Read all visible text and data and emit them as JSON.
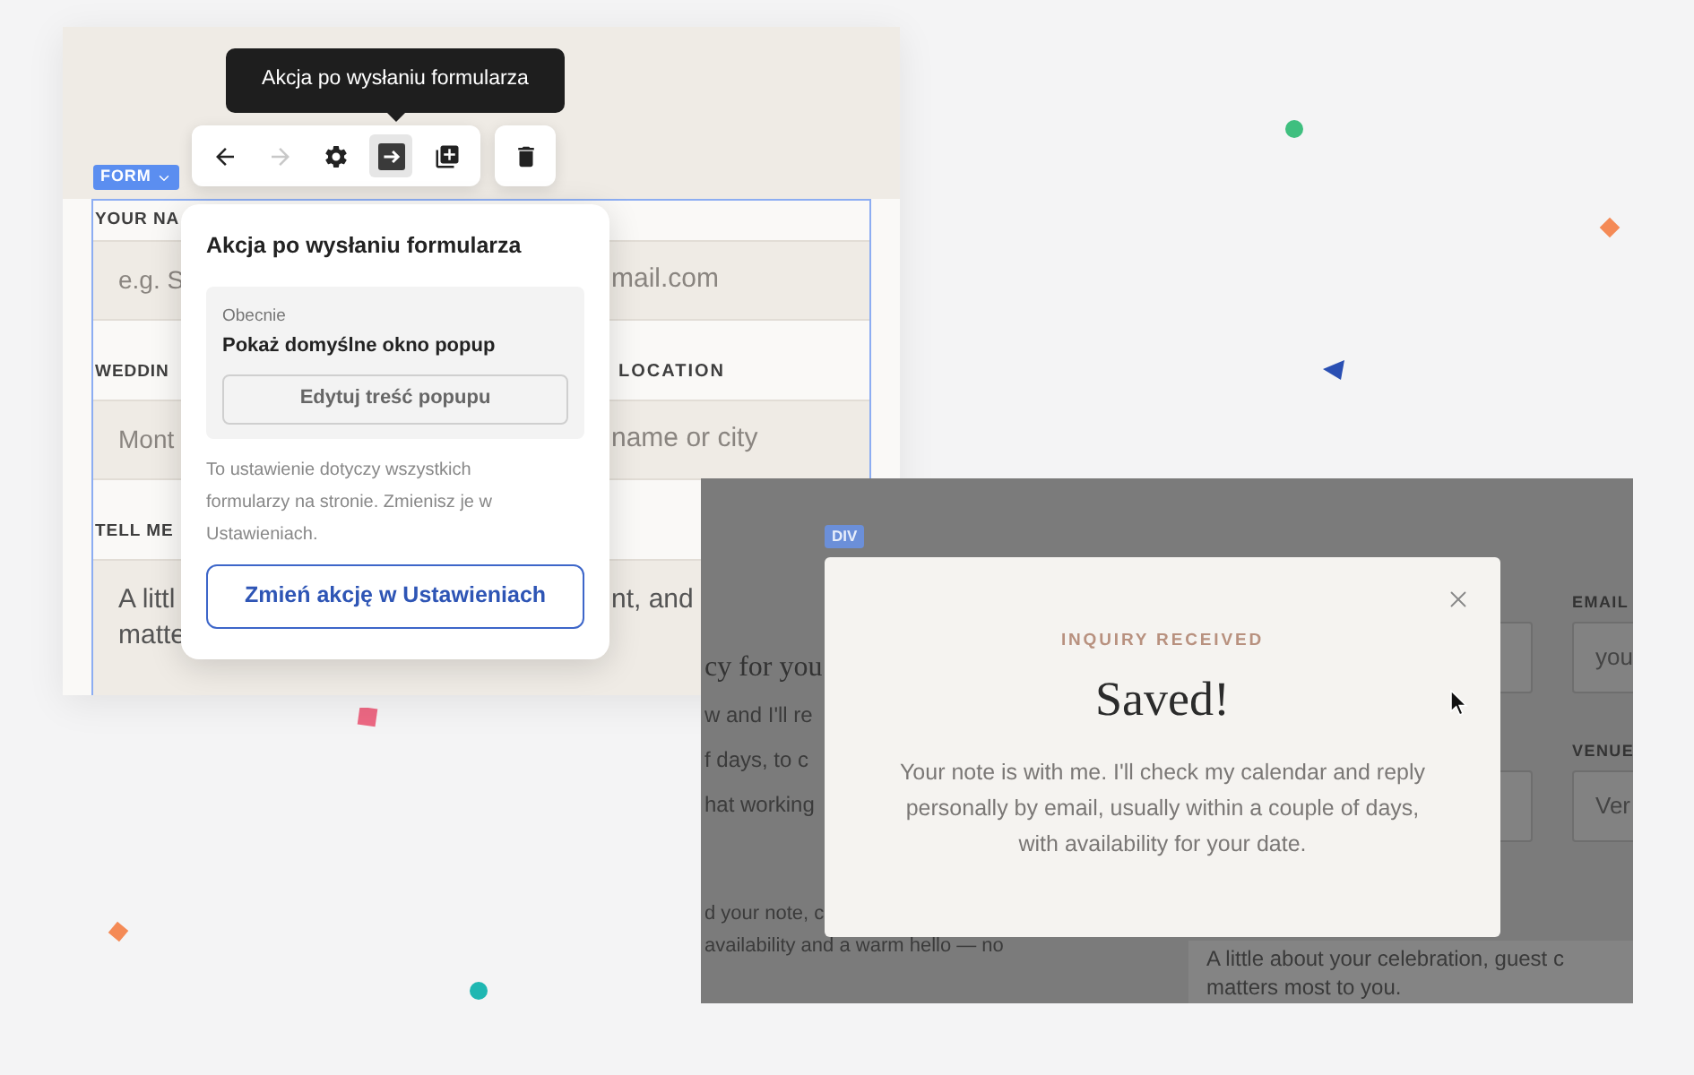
{
  "editor": {
    "tooltip": "Akcja po wysłaniu formularza",
    "toolbar": [
      {
        "kind": "back",
        "disabled": false,
        "selected": false
      },
      {
        "kind": "forward",
        "disabled": true,
        "selected": false
      },
      {
        "kind": "settings",
        "disabled": false,
        "selected": false
      },
      {
        "kind": "redirect",
        "disabled": false,
        "selected": true
      },
      {
        "kind": "duplicate",
        "disabled": false,
        "selected": false
      }
    ],
    "toolbar_trailing": [
      {
        "kind": "delete",
        "disabled": false,
        "selected": false
      }
    ],
    "element_badge": "FORM",
    "form_rows": [
      {
        "kind": "label",
        "left": "YOUR NA"
      },
      {
        "kind": "field",
        "left": "e.g. S",
        "right": "mail.com"
      },
      {
        "kind": "label",
        "left": "WEDDIN",
        "right": "LOCATION"
      },
      {
        "kind": "field",
        "left": "Mont",
        "right": "name or city"
      },
      {
        "kind": "label",
        "left": "TELL ME"
      },
      {
        "kind": "textarea",
        "left_lines": [
          "A littl",
          "matte"
        ],
        "right_lines": [
          "nt, and"
        ]
      }
    ],
    "popover": {
      "title": "Akcja po wysłaniu formularza",
      "current_label": "Obecnie",
      "current_value": "Pokaż domyślne okno popup",
      "edit_button": "Edytuj treść popupu",
      "note": "To ustawienie dotyczy wszystkich formularzy na stronie. Zmienisz je w Ustawieniach.",
      "action_button": "Zmień akcję w Ustawieniach"
    }
  },
  "preview": {
    "background_text": [
      {
        "kind": "heading",
        "text": "cy for you"
      },
      {
        "kind": "body",
        "text": "w and I'll re"
      },
      {
        "kind": "body",
        "text": "f days, to c"
      },
      {
        "kind": "body",
        "text": "hat working"
      },
      {
        "kind": "small",
        "text": "d your note, c"
      },
      {
        "kind": "small",
        "text": "availability and a warm hello — no"
      }
    ],
    "fields": [
      {
        "label": "EMAIL",
        "value": "you"
      },
      {
        "label": "VENUE",
        "value": "Ver"
      }
    ],
    "textarea_lines": [
      "A little about your celebration, guest c",
      "matters most to you."
    ],
    "element_badge": "DIV",
    "modal": {
      "eyebrow": "INQUIRY RECEIVED",
      "title": "Saved!",
      "message": "Your note is with me. I'll check my calendar and reply personally by email, usually within a couple of days, with availability for your date."
    }
  }
}
